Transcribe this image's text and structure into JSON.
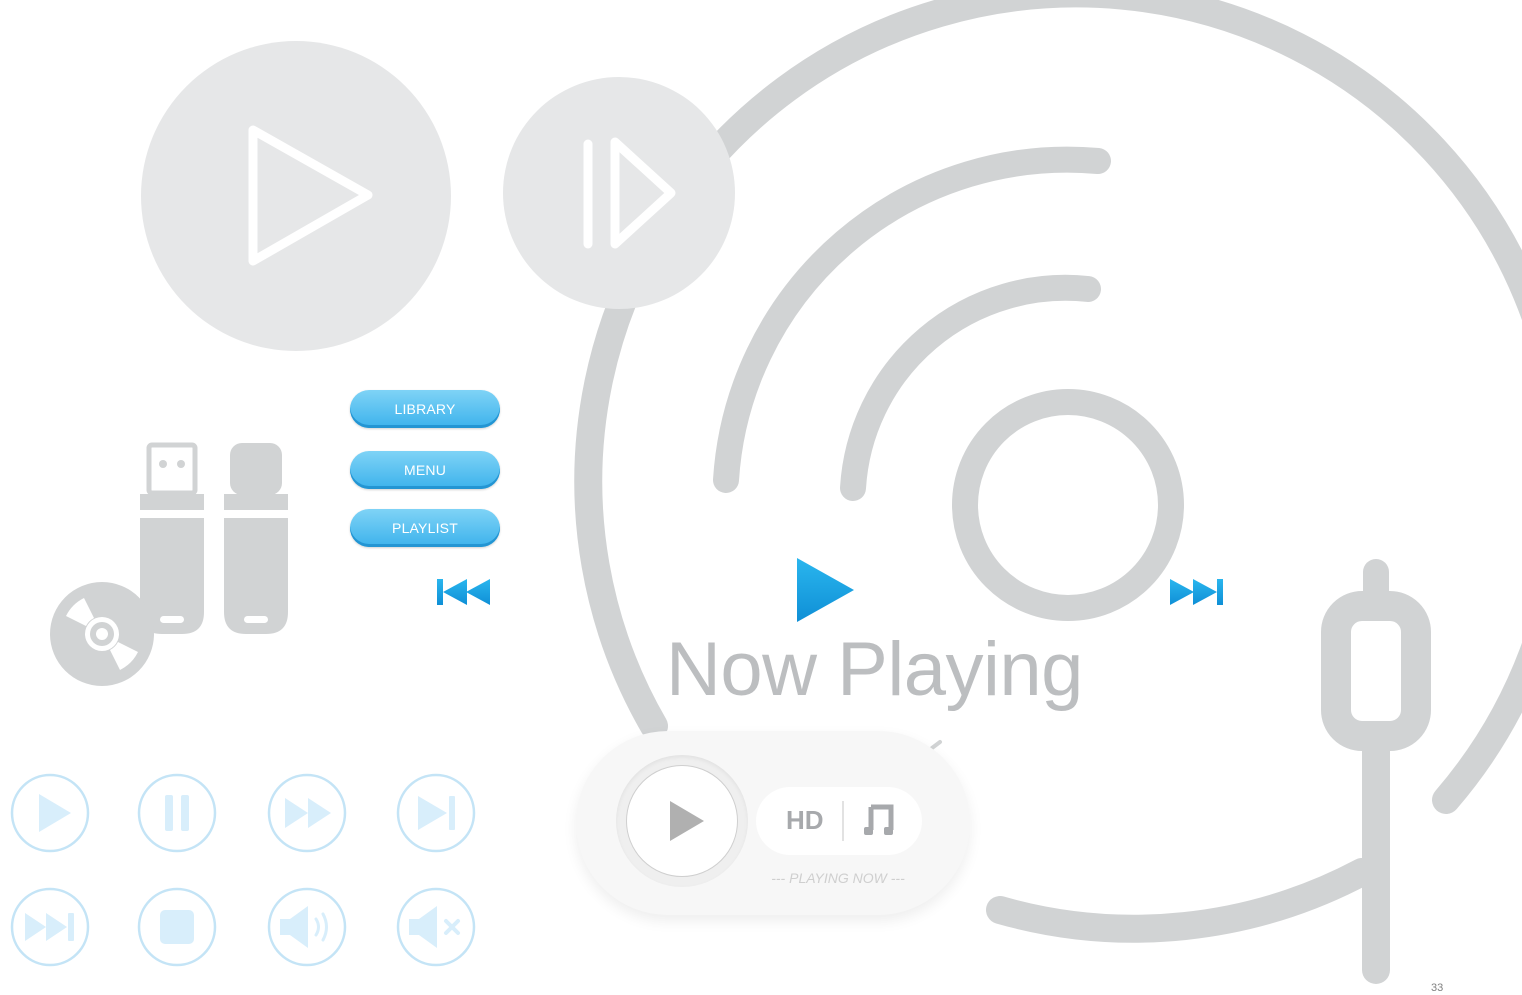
{
  "menu": {
    "library_label": "LIBRARY",
    "menu_label": "MENU",
    "playlist_label": "PLAYLIST"
  },
  "heading": {
    "now_playing": "Now Playing"
  },
  "widget": {
    "quality_label": "HD",
    "caption": "--- PLAYING NOW ---"
  },
  "page_number": "33",
  "icons": {
    "top": [
      "play-icon",
      "play-pause-icon"
    ],
    "left_devices": [
      "usb-drive-icon",
      "usb-drive-capped-icon",
      "disc-icon"
    ],
    "transport": [
      "previous-track-icon",
      "play-icon",
      "next-track-icon"
    ],
    "outline_row_1": [
      "play-icon",
      "pause-icon",
      "fast-forward-icon",
      "skip-next-icon"
    ],
    "outline_row_2": [
      "fast-forward-end-icon",
      "stop-icon",
      "volume-icon",
      "mute-icon"
    ],
    "widget": [
      "play-icon",
      "music-note-icon"
    ],
    "decor": [
      "vinyl-record-icon",
      "audio-jack-icon"
    ]
  },
  "colors": {
    "accent_blue": "#1ba1e2",
    "light_blue": "#d8eefb",
    "outline_blue": "#c4e4f6",
    "gray": "#d1d3d4",
    "light_gray": "#e6e7e8",
    "text_gray": "#bcbec0"
  }
}
